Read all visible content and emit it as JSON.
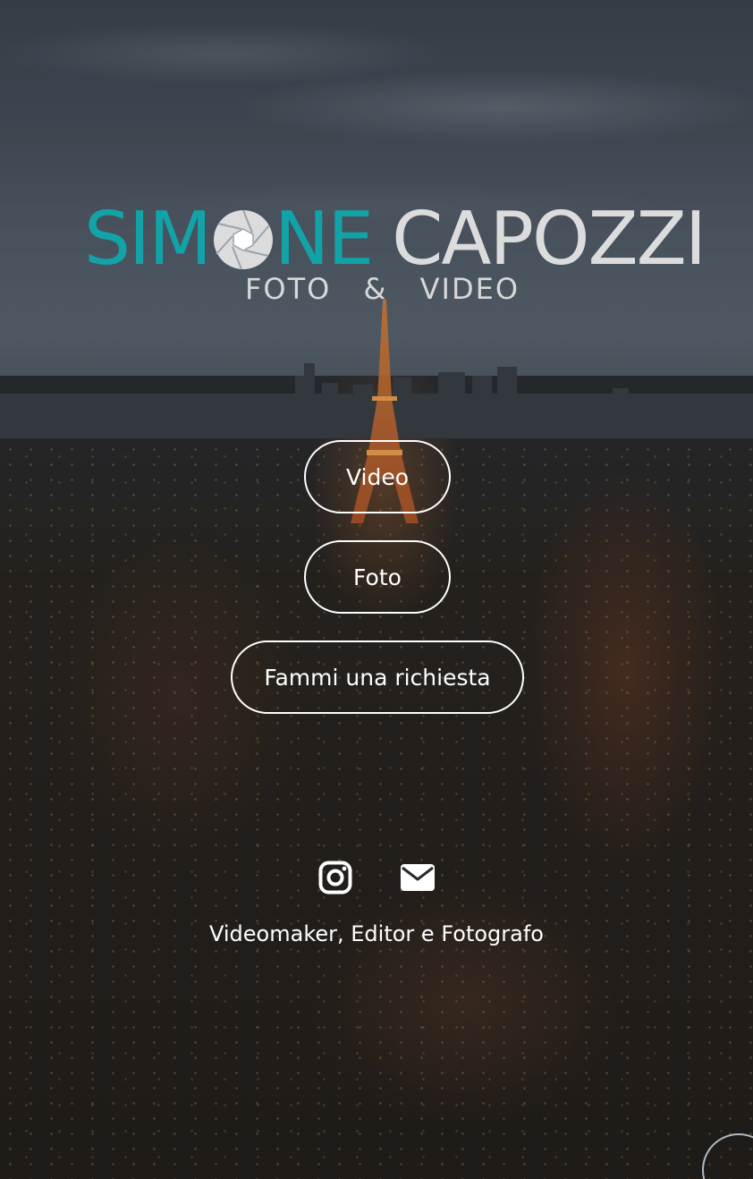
{
  "logo": {
    "first_name_part1": "SIM",
    "first_name_part2": "NE",
    "last_name": "CAPOZZI",
    "subtitle": "FOTO & VIDEO",
    "icon": "camera-aperture-icon",
    "colors": {
      "first_name": "#12a3a8",
      "last_name": "#dcdcdc"
    }
  },
  "nav": {
    "video_label": "Video",
    "foto_label": "Foto",
    "request_label": "Fammi una richiesta"
  },
  "social": {
    "instagram_icon": "instagram-icon",
    "mail_icon": "mail-icon"
  },
  "tagline": "Videomaker, Editor e Fotografo",
  "colors": {
    "button_border": "#ffffff",
    "text": "#ffffff"
  }
}
